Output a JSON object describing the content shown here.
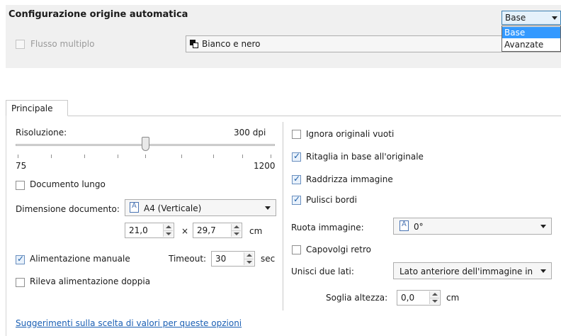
{
  "top": {
    "title": "Configurazione origine automatica",
    "multistream_label": "Flusso multiplo",
    "color_mode": "Bianco e nero",
    "mode_select": {
      "selected": "Base",
      "options": [
        "Base",
        "Avanzate"
      ]
    }
  },
  "tabs": {
    "main": "Principale"
  },
  "left": {
    "resolution_label": "Risoluzione:",
    "resolution_value": "300 dpi",
    "resolution_min": "75",
    "resolution_max": "1200",
    "long_document_label": "Documento lungo",
    "document_size_label": "Dimensione documento:",
    "document_size_value": "A4 (Verticale)",
    "width_value": "21,0",
    "times_sign": "×",
    "height_value": "29,7",
    "unit_cm": "cm",
    "manual_feed_label": "Alimentazione manuale",
    "timeout_label": "Timeout:",
    "timeout_value": "30",
    "timeout_unit": "sec",
    "double_feed_label": "Rileva alimentazione doppia"
  },
  "right": {
    "ignore_blank_label": "Ignora originali vuoti",
    "crop_label": "Ritaglia in base all'originale",
    "straighten_label": "Raddrizza immagine",
    "clean_edges_label": "Pulisci bordi",
    "rotate_label": "Ruota immagine:",
    "rotate_value": "0°",
    "flip_back_label": "Capovolgi retro",
    "merge_label": "Unisci due lati:",
    "merge_value": "Lato anteriore dell'immagine in",
    "height_threshold_label": "Soglia altezza:",
    "height_threshold_value": "0,0",
    "height_threshold_unit": "cm"
  },
  "checkbox_states": {
    "multistream": false,
    "long_document": false,
    "manual_feed": true,
    "double_feed": false,
    "ignore_blank": false,
    "crop": true,
    "straighten": true,
    "clean_edges": true,
    "flip_back": false
  },
  "help_link": "Suggerimenti sulla scelta di valori per queste opzioni",
  "colors": {
    "panel_bg": "#f0f0f0",
    "accent": "#3399ff",
    "link": "#1a5fb4"
  }
}
